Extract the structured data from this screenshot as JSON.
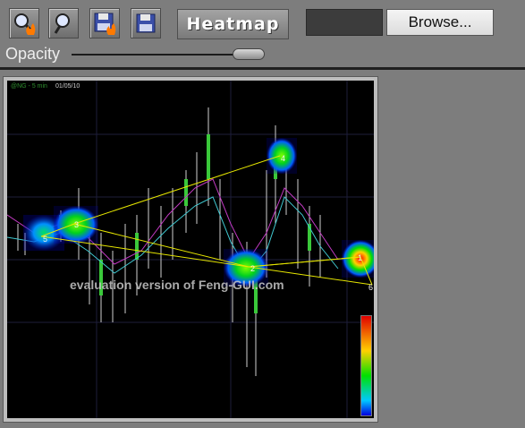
{
  "toolbar": {
    "buttons": [
      {
        "name": "zoom-heat-button",
        "icon": "magnifier-fire-icon"
      },
      {
        "name": "zoom-button",
        "icon": "magnifier-icon"
      },
      {
        "name": "save-heat-button",
        "icon": "floppy-fire-icon"
      },
      {
        "name": "save-button",
        "icon": "floppy-icon"
      }
    ],
    "heatmap_label": "Heatmap",
    "browse_label": "Browse...",
    "file_path_value": ""
  },
  "opacity": {
    "label": "Opacity",
    "value": 0.9
  },
  "chart": {
    "symbol_label": "@NG - 5 min",
    "date_label": "01/05/10",
    "watermark": "evaluation version of Feng-GUI.com",
    "markers": [
      "1",
      "2",
      "3",
      "4",
      "5",
      "6"
    ]
  },
  "colors": {
    "background": "#7d7d7d",
    "chart_bg": "#000000",
    "path_line": "#e6e600"
  }
}
